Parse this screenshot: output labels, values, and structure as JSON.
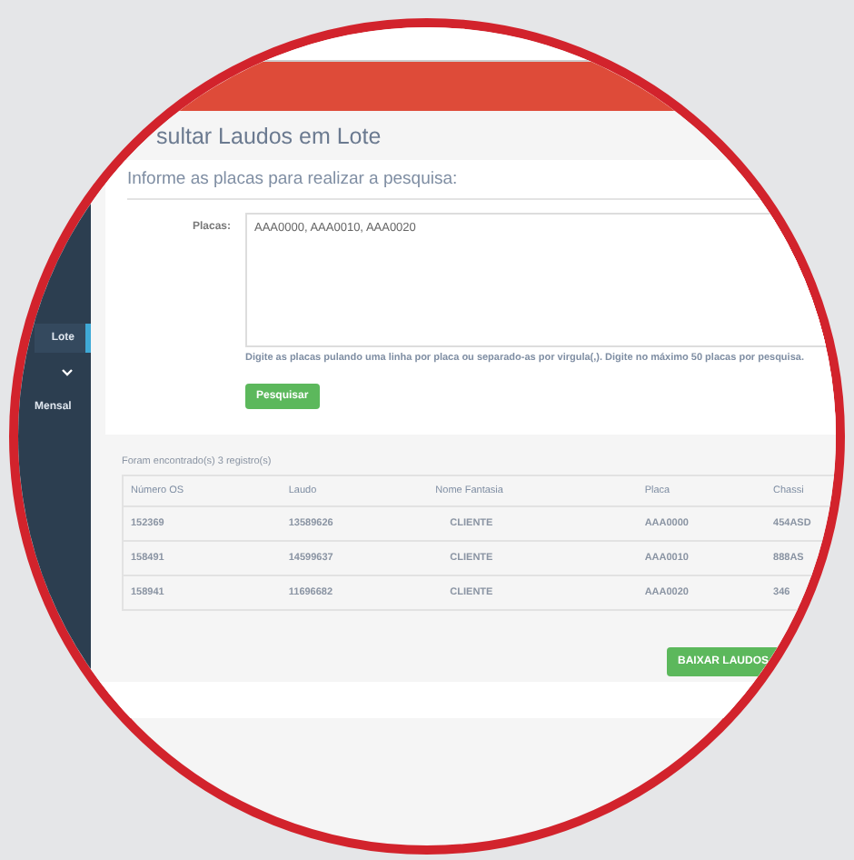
{
  "page_title": "sultar Laudos em Lote",
  "sidebar": {
    "items": [
      {
        "label": "Lote",
        "selected": true,
        "expandable": false
      },
      {
        "selected": false,
        "expandable": true
      },
      {
        "label": "Mensal",
        "selected": false,
        "expandable": false
      }
    ]
  },
  "form": {
    "subtitle": "Informe as placas para realizar a pesquisa:",
    "field_label": "Placas:",
    "value": "AAA0000, AAA0010, AAA0020",
    "hint": "Digite as placas pulando uma linha por placa ou separado-as por virgula(,). Digite no máximo 50 placas por pesquisa.",
    "submit": "Pesquisar"
  },
  "results": {
    "summary": "Foram encontrado(s) 3 registro(s)",
    "table": {
      "columns": [
        "Número OS",
        "Laudo",
        "Nome Fantasia",
        "Placa",
        "Chassi"
      ],
      "rows": [
        [
          "152369",
          "13589626",
          "CLIENTE",
          "AAA0000",
          "454ASD"
        ],
        [
          "158491",
          "14599637",
          "CLIENTE",
          "AAA0010",
          "888AS"
        ],
        [
          "158941",
          "11696682",
          "CLIENTE",
          "AAA0020",
          "346"
        ]
      ]
    },
    "download_button": "BAIXAR LAUDOS"
  }
}
